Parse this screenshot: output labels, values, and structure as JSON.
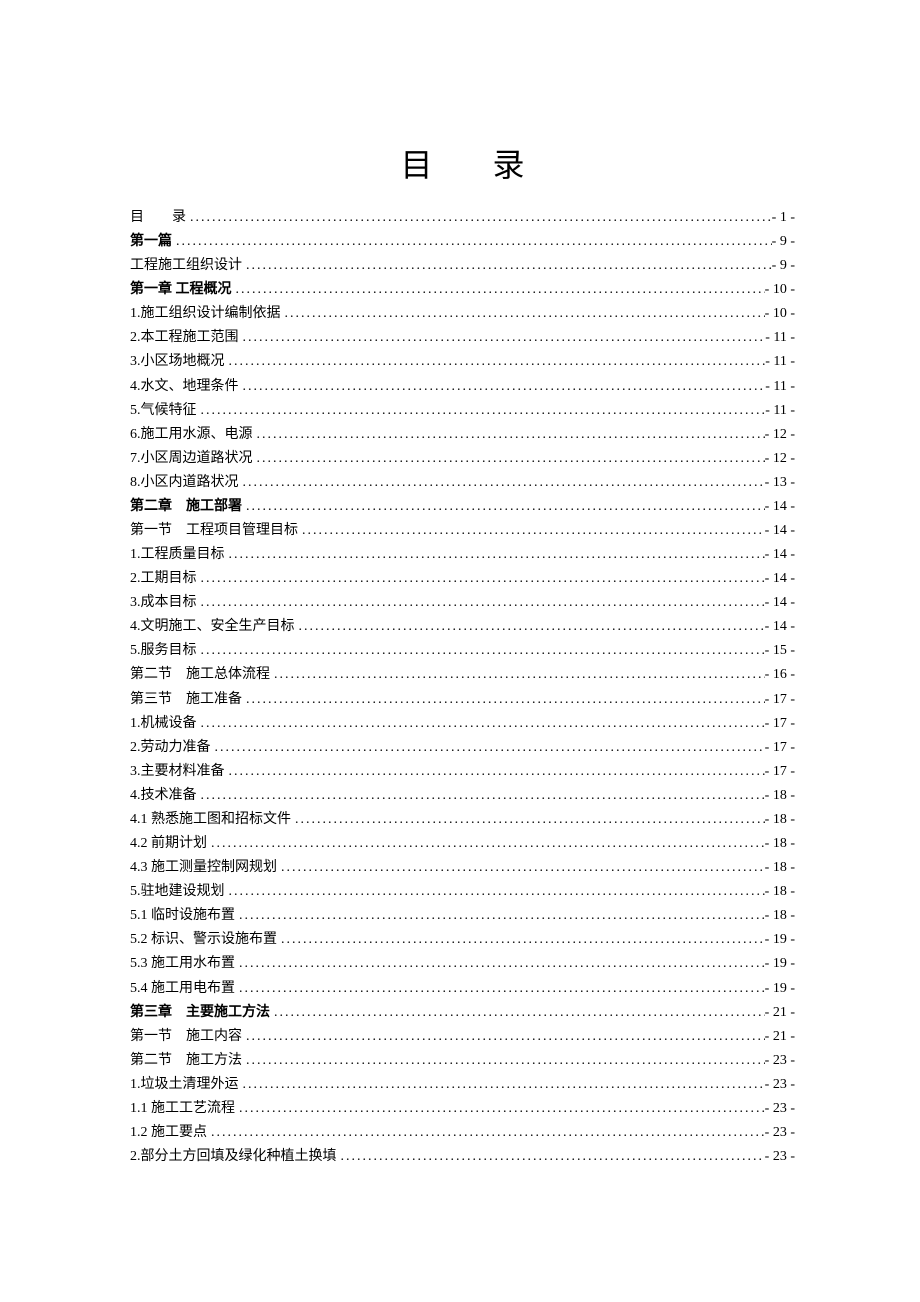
{
  "title_char1": "目",
  "title_char2": "录",
  "entries": [
    {
      "label": "目　　录",
      "page": "- 1 -",
      "bold": false
    },
    {
      "label": "第一篇",
      "page": "- 9 -",
      "bold": true
    },
    {
      "label": "工程施工组织设计",
      "page": "- 9 -",
      "bold": false
    },
    {
      "label": "第一章 工程概况",
      "page": "- 10 -",
      "bold": true
    },
    {
      "label": "1.施工组织设计编制依据",
      "page": "- 10 -",
      "bold": false
    },
    {
      "label": "2.本工程施工范围",
      "page": "- 11 -",
      "bold": false
    },
    {
      "label": "3.小区场地概况",
      "page": "- 11 -",
      "bold": false
    },
    {
      "label": "4.水文、地理条件",
      "page": "- 11 -",
      "bold": false
    },
    {
      "label": "5.气候特征",
      "page": "- 11 -",
      "bold": false
    },
    {
      "label": "6.施工用水源、电源",
      "page": "- 12 -",
      "bold": false
    },
    {
      "label": "7.小区周边道路状况",
      "page": "- 12 -",
      "bold": false
    },
    {
      "label": "8.小区内道路状况",
      "page": "- 13 -",
      "bold": false
    },
    {
      "label": "第二章　施工部署",
      "page": "- 14 -",
      "bold": true
    },
    {
      "label": "第一节　工程项目管理目标",
      "page": "- 14 -",
      "bold": false
    },
    {
      "label": "1.工程质量目标",
      "page": "- 14 -",
      "bold": false
    },
    {
      "label": "2.工期目标",
      "page": "- 14 -",
      "bold": false
    },
    {
      "label": "3.成本目标",
      "page": "- 14 -",
      "bold": false
    },
    {
      "label": "4.文明施工、安全生产目标",
      "page": "- 14 -",
      "bold": false
    },
    {
      "label": "5.服务目标",
      "page": "- 15 -",
      "bold": false
    },
    {
      "label": "第二节　施工总体流程",
      "page": "- 16 -",
      "bold": false
    },
    {
      "label": "第三节　施工准备",
      "page": "- 17 -",
      "bold": false
    },
    {
      "label": "1.机械设备",
      "page": "- 17 -",
      "bold": false
    },
    {
      "label": "2.劳动力准备",
      "page": "- 17 -",
      "bold": false
    },
    {
      "label": "3.主要材料准备",
      "page": "- 17 -",
      "bold": false
    },
    {
      "label": "4.技术准备",
      "page": "- 18 -",
      "bold": false
    },
    {
      "label": "4.1 熟悉施工图和招标文件",
      "page": "- 18 -",
      "bold": false
    },
    {
      "label": "4.2 前期计划",
      "page": "- 18 -",
      "bold": false
    },
    {
      "label": "4.3 施工测量控制网规划",
      "page": "- 18 -",
      "bold": false
    },
    {
      "label": "5.驻地建设规划",
      "page": "- 18 -",
      "bold": false
    },
    {
      "label": "5.1 临时设施布置",
      "page": "- 18 -",
      "bold": false
    },
    {
      "label": "5.2 标识、警示设施布置",
      "page": "- 19 -",
      "bold": false
    },
    {
      "label": "5.3 施工用水布置",
      "page": "- 19 -",
      "bold": false
    },
    {
      "label": "5.4 施工用电布置",
      "page": "- 19 -",
      "bold": false
    },
    {
      "label": "第三章　主要施工方法",
      "page": "- 21 -",
      "bold": true
    },
    {
      "label": "第一节　施工内容",
      "page": "- 21 -",
      "bold": false
    },
    {
      "label": "第二节　施工方法",
      "page": "- 23 -",
      "bold": false
    },
    {
      "label": "1.垃圾土清理外运",
      "page": "- 23 -",
      "bold": false
    },
    {
      "label": "1.1 施工工艺流程",
      "page": "- 23 -",
      "bold": false
    },
    {
      "label": "1.2 施工要点",
      "page": "- 23 -",
      "bold": false
    },
    {
      "label": "2.部分土方回填及绿化种植土换填",
      "page": "- 23 -",
      "bold": false
    }
  ]
}
